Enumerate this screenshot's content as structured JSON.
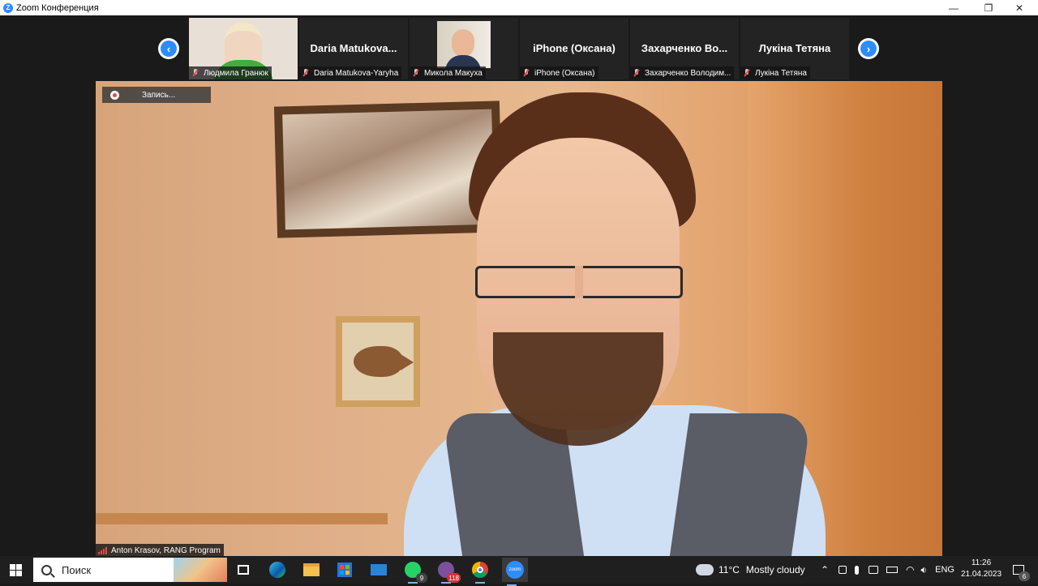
{
  "window": {
    "title": "Zoom Конференция",
    "minimize": "—",
    "maximize": "❐",
    "close": "✕"
  },
  "strip": {
    "prev": "‹",
    "next": "›",
    "tiles": [
      {
        "big": "",
        "label": "Людмила Гранюк",
        "muted": true
      },
      {
        "big": "Daria  Matukova...",
        "label": "Daria Matukova-Yaryha",
        "muted": true
      },
      {
        "big": "",
        "label": "Микола Макуха",
        "muted": true
      },
      {
        "big": "iPhone (Оксана)",
        "label": "iPhone (Оксана)",
        "muted": true
      },
      {
        "big": "Захарченко  Во...",
        "label": "Захарченко Володим...",
        "muted": true
      },
      {
        "big": "Лукіна Тетяна",
        "label": "Лукіна Тетяна",
        "muted": true
      }
    ]
  },
  "main": {
    "recording": "Запись...",
    "speaker": "Anton Krasov, RANG Program"
  },
  "taskbar": {
    "search_placeholder": "Поиск",
    "whatsapp_badge": "9",
    "viber_badge": "118",
    "zoom_label": "zoom",
    "weather_temp": "11°C",
    "weather_desc": "Mostly cloudy",
    "lang": "ENG",
    "time": "11:26",
    "date": "21.04.2023",
    "notifications": "6"
  },
  "colors": {
    "zoom_blue": "#2d8cff",
    "muted_red": "#e5484d",
    "whatsapp": "#25d366",
    "viber": "#7b519d",
    "badge_red": "#d13438"
  }
}
